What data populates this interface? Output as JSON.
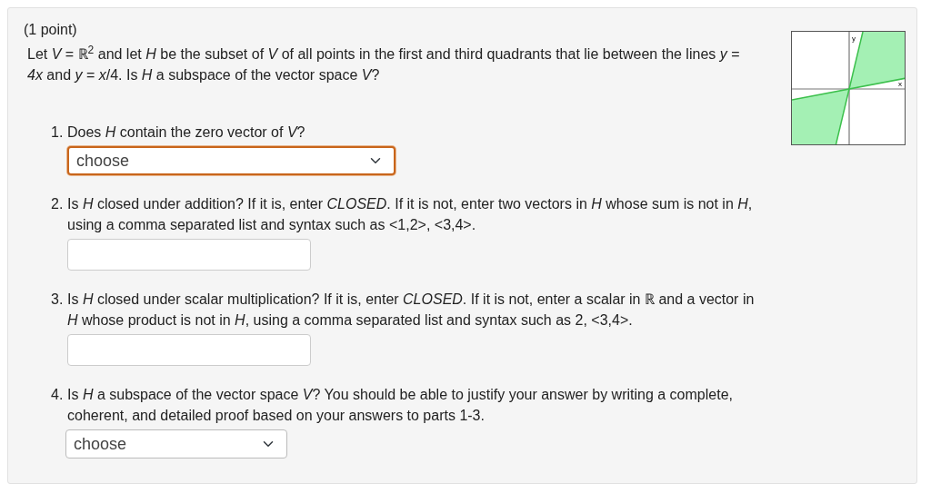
{
  "points": "(1 point)",
  "intro": "Let *V* = ℝ$^{2}$ and let *H* be the subset of *V* of all points in the first and third quadrants that lie between the lines *y* = *4x* and *y* = *x*/4. Is *H* a subspace of the vector space *V*?",
  "graph": {
    "y_label": "y",
    "x_label": "x"
  },
  "questions": [
    {
      "number": "1.",
      "text": "Does *H* contain the zero vector of *V*?",
      "kind": "select",
      "value": "choose",
      "focused": true
    },
    {
      "number": "2.",
      "text": "Is *H* closed under addition? If it is, enter *CLOSED*. If it is not, enter two vectors in *H* whose sum is not in *H*, using a comma separated list and syntax such as <1,2>, <3,4>.",
      "kind": "input",
      "focused": false
    },
    {
      "number": "3.",
      "text": "Is *H* closed under scalar multiplication? If it is, enter *CLOSED*. If it is not, enter a scalar in ℝ and a vector in *H* whose product is not in *H*, using a comma separated list and syntax such as 2, <3,4>.",
      "kind": "input",
      "focused": false
    },
    {
      "number": "4.",
      "text": "Is *H* a subspace of the vector space *V*? You should be able to justify your answer by writing a complete, coherent, and detailed proof based on your answers to parts 1-3.",
      "kind": "select",
      "value": "choose",
      "focused": false
    }
  ]
}
